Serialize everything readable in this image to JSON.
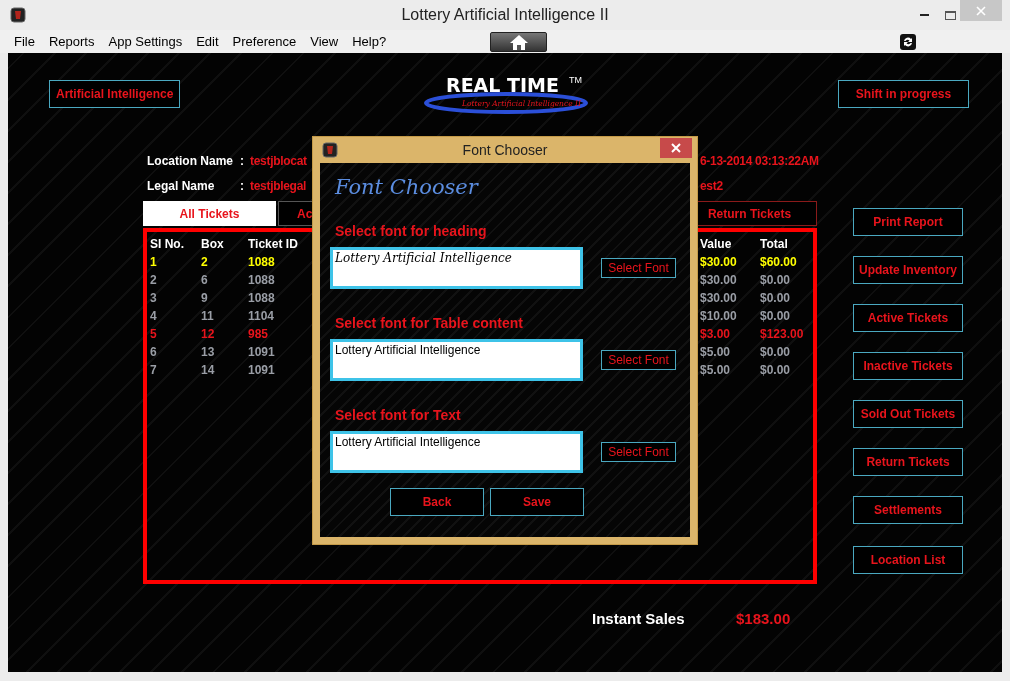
{
  "window": {
    "title": "Lottery Artificial Intelligence II"
  },
  "menu": [
    "File",
    "Reports",
    "App Settings",
    "Edit",
    "Preference",
    "View",
    "Help?"
  ],
  "header": {
    "left_button": "Artificial Intelligence",
    "logo": {
      "title": "REAL TIME",
      "mark": "TM",
      "subtitle": "Lottery Artificial Intelligence II"
    },
    "right_button": "Shift in progress"
  },
  "info": [
    {
      "label": "Location Name",
      "colon": ":",
      "value": "testjblocat",
      "value_right": "6-13-2014 03:13:22AM"
    },
    {
      "label": "Legal Name",
      "colon": ":",
      "value": "testjblegal",
      "value_right": "est2"
    }
  ],
  "tabs": [
    {
      "label": "All Tickets",
      "selected": true
    },
    {
      "label": "Ac",
      "selected": false
    },
    {
      "label": "Return Tickets",
      "selected": false
    }
  ],
  "table": {
    "columns_left": [
      "SI No.",
      "Box",
      "Ticket ID"
    ],
    "columns_right": [
      "Value",
      "Total"
    ],
    "rows": [
      {
        "color": "#ffff00",
        "cells": [
          "1",
          "2",
          "1088",
          "$30.00",
          "$60.00"
        ]
      },
      {
        "color": "#9a9ea6",
        "cells": [
          "2",
          "6",
          "1088",
          "$30.00",
          "$0.00"
        ]
      },
      {
        "color": "#9a9ea6",
        "cells": [
          "3",
          "9",
          "1088",
          "$30.00",
          "$0.00"
        ]
      },
      {
        "color": "#9a9ea6",
        "cells": [
          "4",
          "11",
          "1104",
          "$10.00",
          "$0.00"
        ]
      },
      {
        "color": "#e8141c",
        "cells": [
          "5",
          "12",
          "985",
          "$3.00",
          "$123.00"
        ]
      },
      {
        "color": "#9a9ea6",
        "cells": [
          "6",
          "13",
          "1091",
          "$5.00",
          "$0.00"
        ]
      },
      {
        "color": "#9a9ea6",
        "cells": [
          "7",
          "14",
          "1091",
          "$5.00",
          "$0.00"
        ]
      }
    ]
  },
  "side_buttons": [
    "Print Report",
    "Update Inventory",
    "Active Tickets",
    "Inactive Tickets",
    "Sold Out Tickets",
    "Return Tickets",
    "Settlements",
    "Location List"
  ],
  "summary": {
    "label": "Instant Sales",
    "value": "$183.00"
  },
  "dialog": {
    "title": "Font Chooser",
    "heading": "Font Chooser",
    "sections": [
      {
        "label": "Select font for heading",
        "kind": "script",
        "value": "Lottery Artificial Intelligence",
        "button": "Select Font"
      },
      {
        "label": "Select font for Table content",
        "kind": "plain",
        "value": "Lottery Artificial Intelligence",
        "button": "Select Font"
      },
      {
        "label": "Select font for Text",
        "kind": "plain",
        "value": "Lottery Artificial Intelligence",
        "button": "Select Font"
      }
    ],
    "buttons": [
      "Back",
      "Save"
    ]
  }
}
